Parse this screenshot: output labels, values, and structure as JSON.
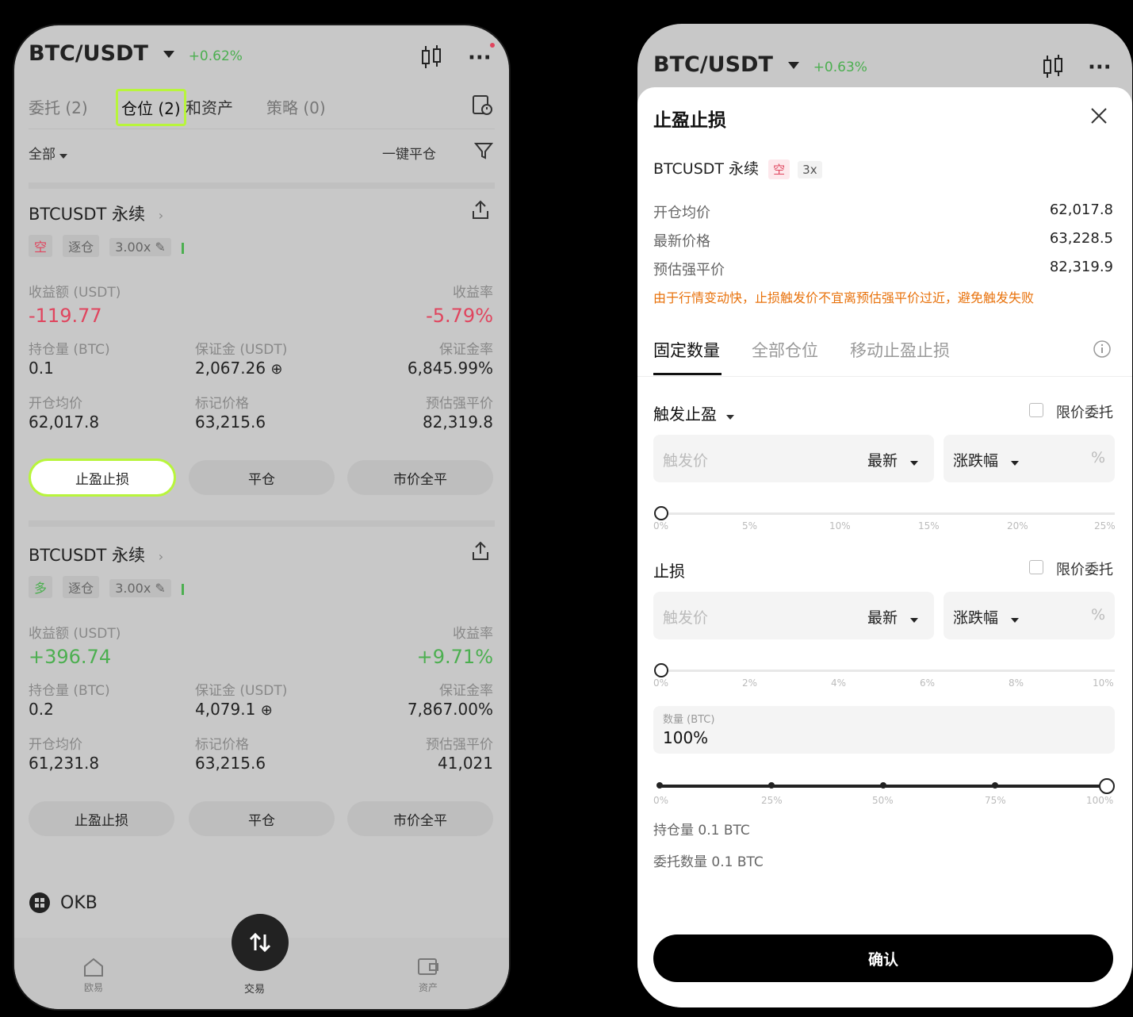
{
  "left": {
    "pair": "BTC/USDT",
    "change": "+0.62%",
    "tabs": [
      "委托 (2)",
      "仓位 (2)",
      "和资产",
      "策略 (0)"
    ],
    "filter": "全部",
    "close_all": "一键平仓",
    "positions": [
      {
        "title": "BTCUSDT 永续",
        "side": "空",
        "mode": "逐仓",
        "leverage": "3.00x",
        "pnl_label": "收益额 (USDT)",
        "pnl": "-119.77",
        "roi_label": "收益率",
        "roi": "-5.79%",
        "size_label": "持仓量 (BTC)",
        "size": "0.1",
        "margin_label": "保证金 (USDT)",
        "margin": "2,067.26",
        "margin_ratio_label": "保证金率",
        "margin_ratio": "6,845.99%",
        "entry_label": "开仓均价",
        "entry": "62,017.8",
        "mark_label": "标记价格",
        "mark": "63,215.6",
        "liq_label": "预估强平价",
        "liq": "82,319.8",
        "buttons": [
          "止盈止损",
          "平仓",
          "市价全平"
        ]
      },
      {
        "title": "BTCUSDT 永续",
        "side": "多",
        "mode": "逐仓",
        "leverage": "3.00x",
        "pnl_label": "收益额 (USDT)",
        "pnl": "+396.74",
        "roi_label": "收益率",
        "roi": "+9.71%",
        "size_label": "持仓量 (BTC)",
        "size": "0.2",
        "margin_label": "保证金 (USDT)",
        "margin": "4,079.1",
        "margin_ratio_label": "保证金率",
        "margin_ratio": "7,867.00%",
        "entry_label": "开仓均价",
        "entry": "61,231.8",
        "mark_label": "标记价格",
        "mark": "63,215.6",
        "liq_label": "预估强平价",
        "liq": "41,021",
        "buttons": [
          "止盈止损",
          "平仓",
          "市价全平"
        ]
      }
    ],
    "asset": "OKB",
    "nav": [
      "欧易",
      "交易",
      "资产"
    ]
  },
  "right": {
    "pair": "BTC/USDT",
    "change": "+0.63%",
    "sheet_title": "止盈止损",
    "contract": "BTCUSDT 永续",
    "side": "空",
    "leverage": "3x",
    "rows": [
      {
        "label": "开仓均价",
        "value": "62,017.8"
      },
      {
        "label": "最新价格",
        "value": "63,228.5"
      },
      {
        "label": "预估强平价",
        "value": "82,319.9"
      }
    ],
    "warning": "由于行情变动快，止损触发价不宜离预估强平价过近，避免触发失败",
    "tabs": [
      "固定数量",
      "全部仓位",
      "移动止盈止损"
    ],
    "tp_label": "触发止盈",
    "limit_label": "限价委托",
    "sl_label": "止损",
    "trigger_placeholder": "触发价",
    "price_type": "最新",
    "change_type": "涨跌幅",
    "pct": "%",
    "tp_ticks": [
      "0%",
      "5%",
      "10%",
      "15%",
      "20%",
      "25%"
    ],
    "sl_ticks": [
      "0%",
      "2%",
      "4%",
      "6%",
      "8%",
      "10%"
    ],
    "qty_label": "数量 (BTC)",
    "qty_value": "100%",
    "qty_ticks": [
      "0%",
      "25%",
      "50%",
      "75%",
      "100%"
    ],
    "hold_text": "持仓量 0.1 BTC",
    "order_text": "委托数量 0.1 BTC",
    "confirm": "确认"
  }
}
